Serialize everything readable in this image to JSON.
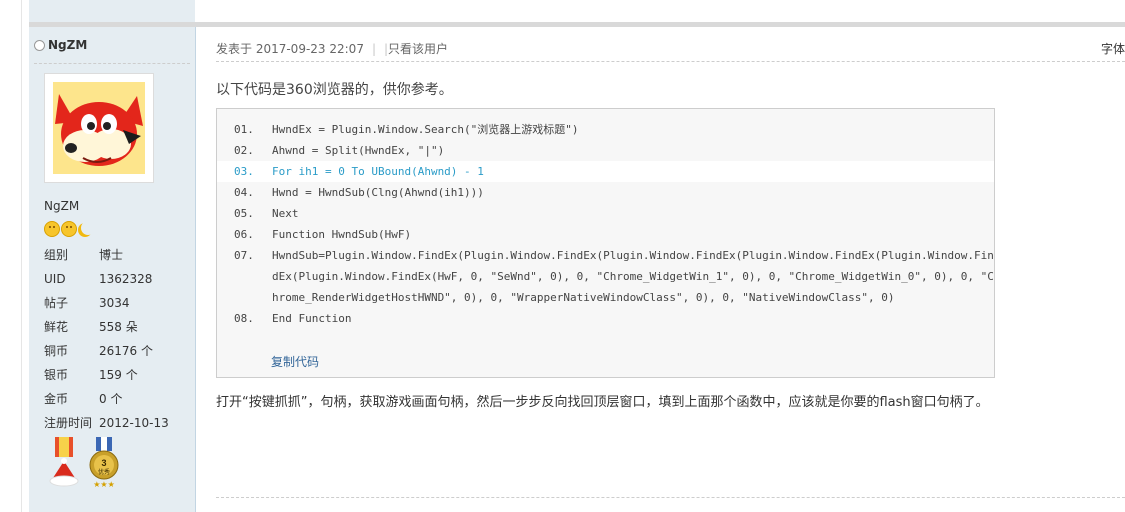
{
  "author": {
    "name": "NgZM",
    "display_name": "NgZM",
    "stats": [
      {
        "key": "组别",
        "value": "博士"
      },
      {
        "key": "UID",
        "value": "1362328"
      },
      {
        "key": "帖子",
        "value": "3034"
      },
      {
        "key": "鲜花",
        "value": "558 朵"
      },
      {
        "key": "铜币",
        "value": "26176 个"
      },
      {
        "key": "银币",
        "value": "159 个"
      },
      {
        "key": "金币",
        "value": "0 个"
      },
      {
        "key": "注册时间",
        "value": "2012-10-13"
      }
    ],
    "badge_level": "3",
    "badge_caption": "优秀"
  },
  "post": {
    "posted_label": "发表于 2017-09-23 22:07",
    "pipe": "|",
    "only_this_user": "只看该用户",
    "font_toggle": "字体",
    "intro": "以下代码是360浏览器的，供你参考。",
    "code_lines": [
      {
        "n": "01.",
        "text": "HwndEx = Plugin.Window.Search(\"浏览器上游戏标题\")"
      },
      {
        "n": "02.",
        "text": "Ahwnd = Split(HwndEx, \"|\")"
      },
      {
        "n": "03.",
        "text": "For ih1 = 0 To UBound(Ahwnd) - 1"
      },
      {
        "n": "04.",
        "text": "Hwnd = HwndSub(Clng(Ahwnd(ih1)))"
      },
      {
        "n": "05.",
        "text": "Next"
      },
      {
        "n": "06.",
        "text": "Function HwndSub(HwF)"
      },
      {
        "n": "07.",
        "text": "HwndSub=Plugin.Window.FindEx(Plugin.Window.FindEx(Plugin.Window.FindEx(Plugin.Window.FindEx(Plugin.Window.FindEx(Plugin.Window.FindEx(HwF, 0, \"SeWnd\", 0), 0, \"Chrome_WidgetWin_1\", 0), 0, \"Chrome_WidgetWin_0\", 0), 0, \"Chrome_RenderWidgetHostHWND\", 0), 0, \"WrapperNativeWindowClass\", 0), 0, \"NativeWindowClass\", 0)"
      },
      {
        "n": "08.",
        "text": "End Function"
      }
    ],
    "copy_code": "复制代码",
    "after_text": "打开“按键抓抓”，句柄，获取游戏画面句柄，然后一步步反向找回顶层窗口，填到上面那个函数中，应该就是你要的flash窗口句柄了。"
  },
  "colors": {
    "sidebar_bg": "#e5edf2",
    "highlight_code": "#2b9cc8",
    "link": "#336699"
  }
}
